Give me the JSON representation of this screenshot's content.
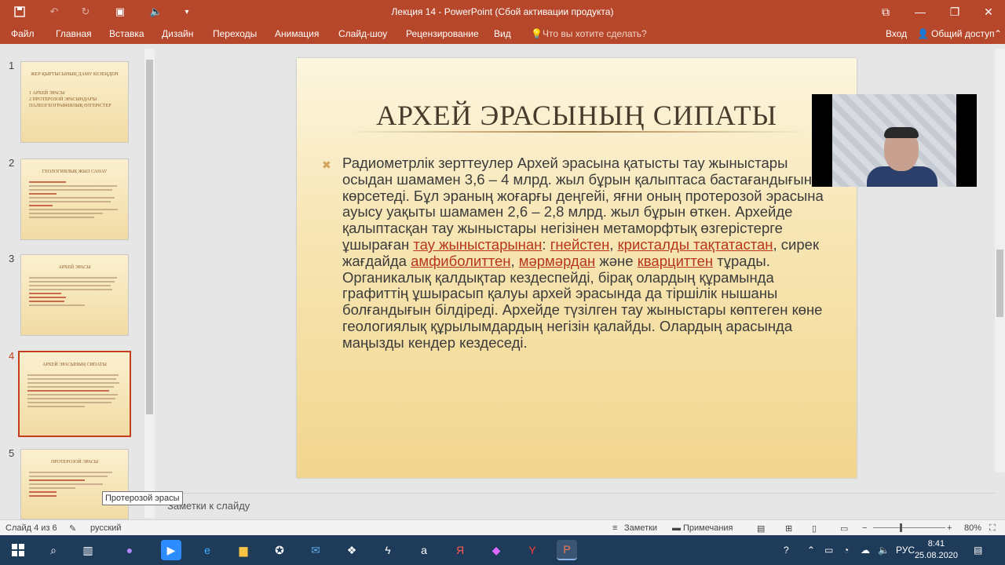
{
  "window": {
    "title": "Лекция 14 - PowerPoint (Сбой активации продукта)"
  },
  "ribbon": {
    "tabs": [
      "Файл",
      "Главная",
      "Вставка",
      "Дизайн",
      "Переходы",
      "Анимация",
      "Слайд-шоу",
      "Рецензирование",
      "Вид"
    ],
    "tell_me": "Что вы хотите сделать?",
    "signin": "Вход",
    "share": "Общий доступ"
  },
  "thumbnails": [
    {
      "num": "1",
      "title": "ЖЕР ҚЫРТЫСЫНЫҢ ДАМУ КЕЗЕҢДЕРІ",
      "sub": "1 АРХЕЙ ЭРАСЫ\n2 ПРОТЕРОЗОЙ ЭРАСЫНДАҒЫ ПАЛЕОГЕОГРАФИЯЛЫҚ ӨЗГЕРІСТЕР"
    },
    {
      "num": "2",
      "title": "ГЕОЛОГИЯЛЫҚ ЖЫЛ САНАУ"
    },
    {
      "num": "3",
      "title": "АРХЕЙ ЭРАСЫ"
    },
    {
      "num": "4",
      "title": "АРХЕЙ ЭРАСЫНЫҢ СИПАТЫ"
    },
    {
      "num": "5",
      "title": "ПРОТЕРОЗОЙ ЭРАСЫ"
    }
  ],
  "slide": {
    "title": "АРХЕЙ ЭРАСЫНЫҢ СИПАТЫ",
    "body_parts": [
      "Радиометрлік зерттеулер Архей эрасына қатысты тау жыныстары осыдан шамамен 3,6 – 4 млрд. жыл бұрын қалыптаса бастағандығын көрсетеді. Бұл эраның жоғарғы деңгейі, яғни оның протерозой эрасына ауысу уақыты шамамен 2,6 – 2,8 млрд. жыл бұрын өткен. Архейде қалыптасқан тау жыныстары негізінен метаморфтық өзгерістерге ұшыраған ",
      "тау жыныстарынан",
      ": ",
      "гнейстен",
      ", ",
      "кристалды тақтатастан",
      ", сирек жағдайда ",
      "амфиболиттен",
      ", ",
      "мәрмәрдан",
      " және ",
      "кварциттен",
      " тұрады. Органикалық қалдықтар кездеспейді, бірақ олардың құрамында графиттің ұшырасып қалуы архей эрасында да тіршілік нышаны болғандығын білдіреді. Архейде түзілген тау жыныстары көптеген көне геологиялық құрылымдардың негізін қалайды. Олардың арасында маңызды кендер кездеседі."
    ]
  },
  "notes_placeholder": "Заметки к слайду",
  "tooltip": "Протерозой эрасы",
  "statusbar": {
    "slide_of": "Слайд 4 из 6",
    "language": "русский",
    "notes": "Заметки",
    "comments": "Примечания",
    "zoom": "80%"
  },
  "taskbar": {
    "lang": "РУС",
    "time": "8:41",
    "date": "25.08.2020"
  },
  "colors": {
    "accent": "#b7472a",
    "hyperlink": "#b8351c",
    "taskbar": "#1f3b5a"
  }
}
